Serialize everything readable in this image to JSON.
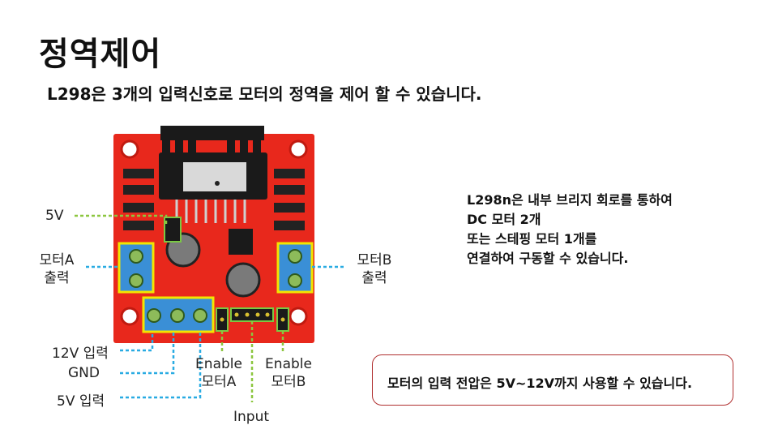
{
  "title": "정역제어",
  "subtitle": "L298은 3개의 입력신호로 모터의 정역을 제어 할 수 있습니다.",
  "labels": {
    "v5": "5V",
    "motorA_line1": "모터A",
    "motorA_line2": "출력",
    "motorB_line1": "모터B",
    "motorB_line2": "출력",
    "v12_input": "12V 입력",
    "gnd": "GND",
    "v5_input": "5V 입력",
    "enableA_line1": "Enable",
    "enableA_line2": "모터A",
    "enableB_line1": "Enable",
    "enableB_line2": "모터B",
    "input": "Input"
  },
  "description": [
    "L298n은 내부 브리지 회로를 통하여",
    "DC 모터 2개",
    "또는 스테핑 모터 1개를",
    "연결하여 구동할 수 있습니다."
  ],
  "note": "모터의 입력 전압은 5V~12V까지 사용할 수 있습니다.",
  "colors": {
    "board_red": "#e8281c",
    "highlight_yellow": "#f2e600",
    "highlight_green": "#7ac943",
    "callout_blue": "#29abe2",
    "callout_green": "#8cc63f",
    "note_border": "#b03030"
  }
}
